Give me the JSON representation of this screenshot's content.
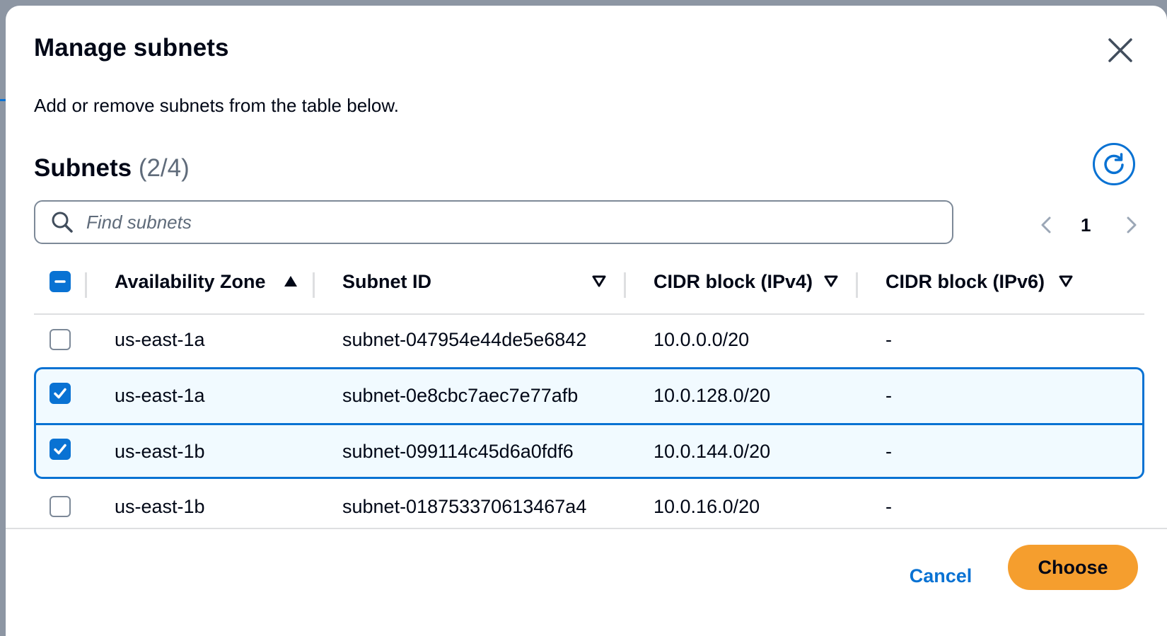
{
  "modal": {
    "title": "Manage subnets",
    "description": "Add or remove subnets from the table below."
  },
  "table_header": {
    "title": "Subnets",
    "count": "(2/4)"
  },
  "search": {
    "placeholder": "Find subnets",
    "value": ""
  },
  "pagination": {
    "current_page": "1"
  },
  "columns": [
    {
      "label": "Availability Zone",
      "sort": "ascending"
    },
    {
      "label": "Subnet ID",
      "sort": "sortable"
    },
    {
      "label": "CIDR block (IPv4)",
      "sort": "sortable"
    },
    {
      "label": "CIDR block (IPv6)",
      "sort": "sortable"
    }
  ],
  "select_all_state": "indeterminate",
  "rows": [
    {
      "az": "us-east-1a",
      "subnet_id": "subnet-047954e44de5e6842",
      "cidr_ipv4": "10.0.0.0/20",
      "cidr_ipv6": "-",
      "selected": false
    },
    {
      "az": "us-east-1a",
      "subnet_id": "subnet-0e8cbc7aec7e77afb",
      "cidr_ipv4": "10.0.128.0/20",
      "cidr_ipv6": "-",
      "selected": true
    },
    {
      "az": "us-east-1b",
      "subnet_id": "subnet-099114c45d6a0fdf6",
      "cidr_ipv4": "10.0.144.0/20",
      "cidr_ipv6": "-",
      "selected": true
    },
    {
      "az": "us-east-1b",
      "subnet_id": "subnet-018753370613467a4",
      "cidr_ipv4": "10.0.16.0/20",
      "cidr_ipv6": "-",
      "selected": false
    }
  ],
  "footer": {
    "cancel_label": "Cancel",
    "choose_label": "Choose"
  },
  "colors": {
    "accent": "#0972d3",
    "primary_button": "#f59e2e",
    "selected_row_bg": "#f1faff"
  },
  "icons": {
    "close": "close-icon",
    "refresh": "refresh-icon",
    "search": "search-icon",
    "prev": "chevron-left-icon",
    "next": "chevron-right-icon",
    "sort_asc": "caret-up-filled-icon",
    "sort": "caret-down-outline-icon"
  }
}
